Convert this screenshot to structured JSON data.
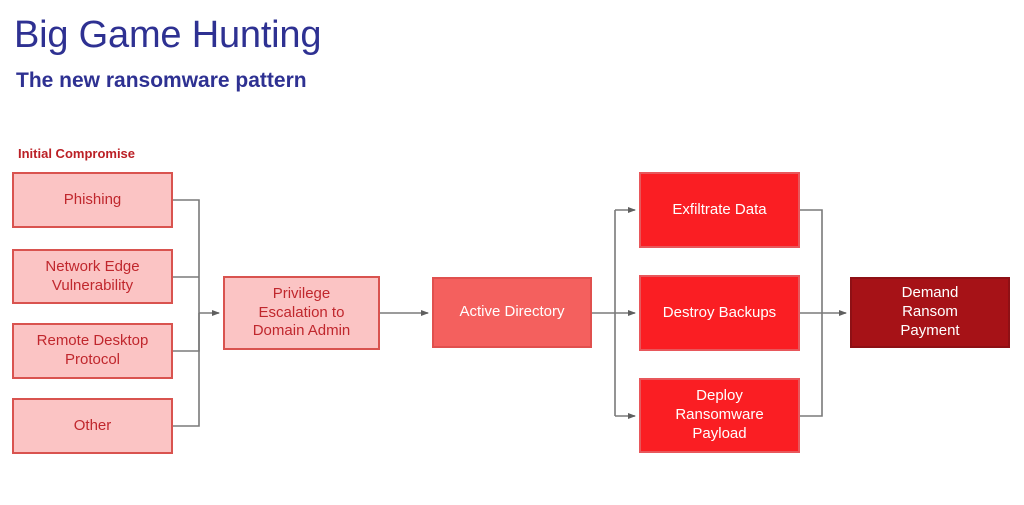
{
  "header": {
    "title": "Big Game Hunting",
    "subtitle": "The new ransomware pattern"
  },
  "colors": {
    "title_blue": "#2e3192",
    "label_red": "#bb2026",
    "pink_fill": "#fbc4c4",
    "pink_border": "#d9534f",
    "pink_text": "#c0272d",
    "salmon_fill": "#f4605e",
    "red_fill": "#fa1e23",
    "darkred_fill": "#a61217",
    "connector": "#6e6e6e"
  },
  "diagram": {
    "group_label": "Initial Compromise",
    "nodes": {
      "phishing": "Phishing",
      "network_edge": "Network Edge\nVulnerability",
      "rdp": "Remote Desktop\nProtocol",
      "other": "Other",
      "privilege": "Privilege\nEscalation to\nDomain Admin",
      "active_directory": "Active Directory",
      "exfiltrate": "Exfiltrate Data",
      "destroy": "Destroy Backups",
      "deploy": "Deploy\nRansomware\nPayload",
      "demand": "Demand\nRansom\nPayment"
    }
  }
}
